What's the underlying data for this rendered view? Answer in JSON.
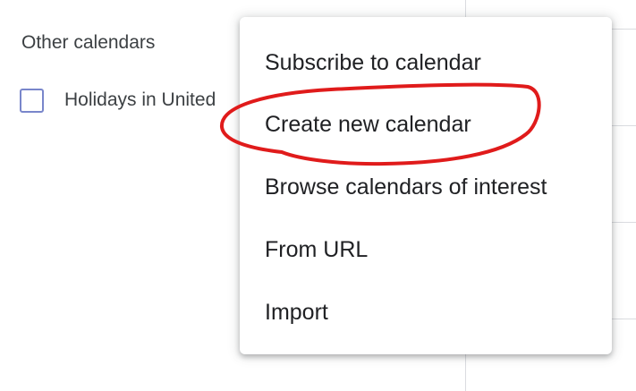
{
  "sidebar": {
    "heading": "Other calendars",
    "calendars": [
      {
        "label": "Holidays in United",
        "checked": false,
        "color": "#7986cb"
      }
    ]
  },
  "menu": {
    "items": [
      {
        "label": "Subscribe to calendar"
      },
      {
        "label": "Create new calendar"
      },
      {
        "label": "Browse calendars of interest"
      },
      {
        "label": "From URL"
      },
      {
        "label": "Import"
      }
    ]
  },
  "annotation": {
    "shape": "ellipse",
    "color": "#e01b1b",
    "highlights": "Create new calendar"
  }
}
